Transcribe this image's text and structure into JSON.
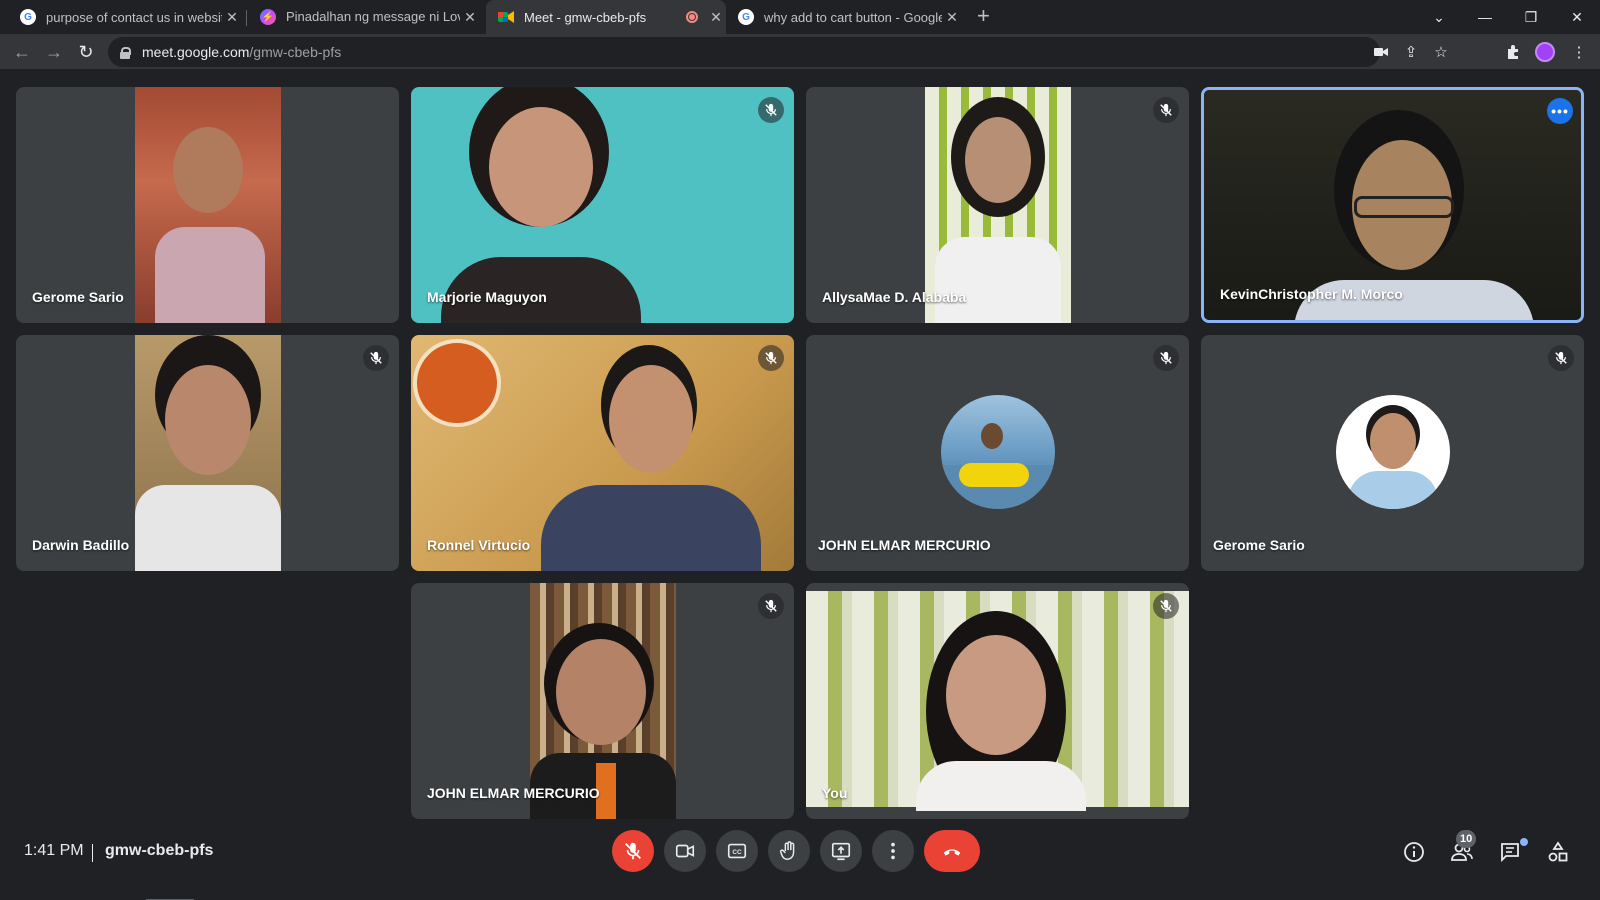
{
  "browser": {
    "tabs": [
      {
        "title": "purpose of contact us in website",
        "icon": "google-icon"
      },
      {
        "title": "Pinadalhan ng message ni Love💌",
        "icon": "messenger-icon"
      },
      {
        "title": "Meet - gmw-cbeb-pfs",
        "icon": "meet-icon",
        "active": true,
        "recording": true
      },
      {
        "title": "why add to cart button - Google",
        "icon": "google-icon"
      }
    ],
    "url_host": "meet.google.com",
    "url_path": "/gmw-cbeb-pfs"
  },
  "participants": [
    {
      "name": "Gerome Sario",
      "mic_muted": false
    },
    {
      "name": "Marjorie Maguyon",
      "mic_muted": true
    },
    {
      "name": "AllysaMae D. Alababa",
      "mic_muted": true
    },
    {
      "name": "KevinChristopher M. Morco",
      "mic_muted": false,
      "active_speaker": true
    },
    {
      "name": "Darwin Badillo",
      "mic_muted": true
    },
    {
      "name": "Ronnel Virtucio",
      "mic_muted": true
    },
    {
      "name": "JOHN ELMAR MERCURIO",
      "mic_muted": true,
      "camera_off": true
    },
    {
      "name": "Gerome Sario",
      "mic_muted": true,
      "camera_off": true
    },
    {
      "name": "JOHN ELMAR MERCURIO",
      "mic_muted": true
    },
    {
      "name": "You",
      "mic_muted": true
    }
  ],
  "meeting": {
    "time": "1:41 PM",
    "code": "gmw-cbeb-pfs",
    "participant_count": "10"
  },
  "colors": {
    "background": "#202124",
    "tile": "#3c4043",
    "accent": "#8ab4f8",
    "danger": "#ea4335"
  }
}
